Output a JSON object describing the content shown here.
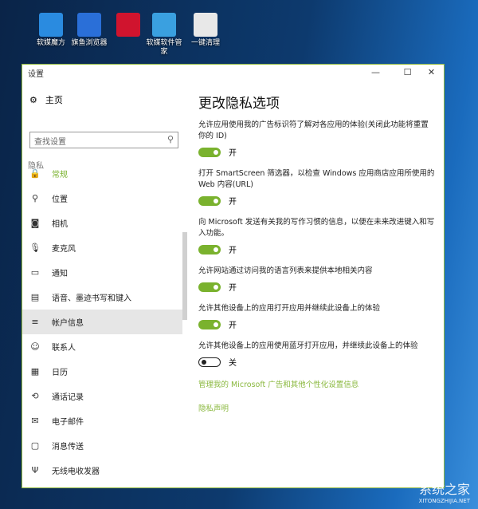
{
  "desktop": {
    "icons": [
      {
        "label": "软媒魔方",
        "color": "#2a8be0"
      },
      {
        "label": "旗鱼浏览器",
        "color": "#2a6fd8"
      },
      {
        "label": "",
        "color": "#d0142e"
      },
      {
        "label": "软媒软件管家",
        "color": "#3aa0e0"
      },
      {
        "label": "一键清理",
        "color": "#e8e8e8"
      }
    ]
  },
  "window": {
    "title": "设置",
    "minimize": "—",
    "maximize": "☐",
    "close": "✕"
  },
  "sidebar": {
    "home": "主页",
    "search_placeholder": "查找设置",
    "group": "隐私",
    "items": [
      {
        "label": "常规",
        "icon": "🔒"
      },
      {
        "label": "位置",
        "icon": "⚲"
      },
      {
        "label": "相机",
        "icon": "◙"
      },
      {
        "label": "麦克风",
        "icon": "🎙"
      },
      {
        "label": "通知",
        "icon": "▭"
      },
      {
        "label": "语音、墨迹书写和键入",
        "icon": "▤"
      },
      {
        "label": "帐户信息",
        "icon": "≡"
      },
      {
        "label": "联系人",
        "icon": "☺"
      },
      {
        "label": "日历",
        "icon": "▦"
      },
      {
        "label": "通话记录",
        "icon": "⟲"
      },
      {
        "label": "电子邮件",
        "icon": "✉"
      },
      {
        "label": "消息传送",
        "icon": "▢"
      },
      {
        "label": "无线电收发器",
        "icon": "Ψ"
      }
    ]
  },
  "main": {
    "title": "更改隐私选项",
    "options": [
      {
        "text": "允许应用使用我的广告标识符了解对各应用的体验(关闭此功能将重置你的 ID)",
        "on": true,
        "state": "开"
      },
      {
        "text": "打开 SmartScreen 筛选器，以检查 Windows 应用商店应用所使用的 Web 内容(URL)",
        "on": true,
        "state": "开"
      },
      {
        "text": "向 Microsoft 发送有关我的写作习惯的信息，以便在未来改进键入和写入功能。",
        "on": true,
        "state": "开"
      },
      {
        "text": "允许网站通过访问我的语言列表来提供本地相关内容",
        "on": true,
        "state": "开"
      },
      {
        "text": "允许其他设备上的应用打开应用并继续此设备上的体验",
        "on": true,
        "state": "开"
      },
      {
        "text": "允许其他设备上的应用使用蓝牙打开应用，并继续此设备上的体验",
        "on": false,
        "state": "关"
      }
    ],
    "links": [
      "管理我的 Microsoft 广告和其他个性化设置信息",
      "隐私声明"
    ]
  },
  "watermark": {
    "name": "系统之家",
    "url": "XITONGZHIJIA.NET"
  }
}
